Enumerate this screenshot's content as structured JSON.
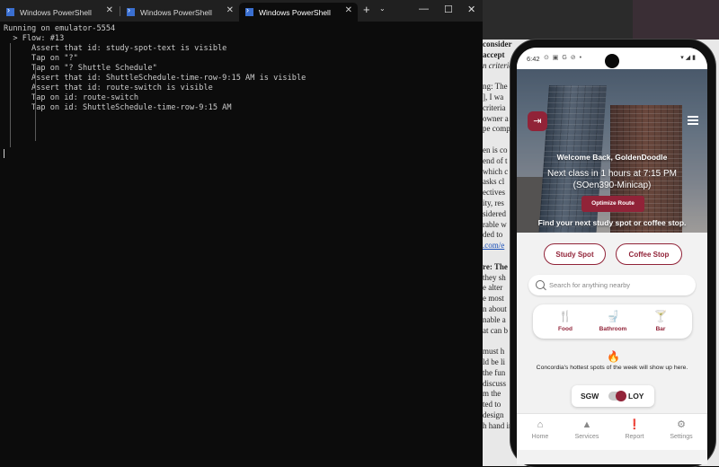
{
  "terminal": {
    "tabs": [
      {
        "title": "Windows PowerShell"
      },
      {
        "title": "Windows PowerShell"
      },
      {
        "title": "Windows PowerShell"
      }
    ],
    "new_tab": "+",
    "dropdown": "⌄",
    "win_min": "—",
    "win_max": "☐",
    "win_close": "✕",
    "tab_close": "✕",
    "lines": [
      "Running on emulator-5554",
      "",
      "",
      "  > Flow: #13",
      "",
      "      Assert that id: study-spot-text is visible",
      "      Tap on \"?\"",
      "      Tap on \"? Shuttle Schedule\"",
      "      Assert that id: ShuttleSchedule-time-row-9:15 AM is visible",
      "      Assert that id: route-switch is visible",
      "      Tap on id: route-switch",
      "      Tap on id: ShuttleSchedule-time-row-9:15 AM"
    ]
  },
  "background_doc": {
    "lines": [
      {
        "text": "consider",
        "style": "bold"
      },
      {
        "text": "accept",
        "style": "bold"
      },
      {
        "text": "n criteria",
        "style": "italic"
      },
      {
        "text": "",
        "style": ""
      },
      {
        "text": "ng: The",
        "style": ""
      },
      {
        "text": "], I wa",
        "style": ""
      },
      {
        "text": "criteria",
        "style": ""
      },
      {
        "text": "owner a",
        "style": ""
      },
      {
        "text": "pe comp",
        "style": ""
      },
      {
        "text": "",
        "style": ""
      },
      {
        "text": "en is co",
        "style": ""
      },
      {
        "text": "end of t",
        "style": ""
      },
      {
        "text": "which c",
        "style": ""
      },
      {
        "text": "asks cl",
        "style": ""
      },
      {
        "text": "ectives",
        "style": ""
      },
      {
        "text": "ity, res",
        "style": ""
      },
      {
        "text": "sidered",
        "style": ""
      },
      {
        "text": "rable w",
        "style": ""
      },
      {
        "text": "ded to",
        "style": ""
      },
      {
        "text": ".com/e",
        "style": "link"
      },
      {
        "text": "",
        "style": ""
      },
      {
        "text": "re: The",
        "style": "bold"
      },
      {
        "text": "they sh",
        "style": ""
      },
      {
        "text": "e alter",
        "style": ""
      },
      {
        "text": "e most",
        "style": ""
      },
      {
        "text": "n about",
        "style": ""
      },
      {
        "text": "nable a",
        "style": ""
      },
      {
        "text": "at can b",
        "style": ""
      },
      {
        "text": "",
        "style": ""
      },
      {
        "text": "must h",
        "style": ""
      },
      {
        "text": "ld be li",
        "style": ""
      },
      {
        "text": "the fun",
        "style": ""
      },
      {
        "text": "discuss",
        "style": ""
      },
      {
        "text": "m the",
        "style": ""
      },
      {
        "text": "ted to",
        "style": ""
      },
      {
        "text": "design",
        "style": ""
      },
      {
        "text": "h hand in",
        "style": ""
      }
    ]
  },
  "phone": {
    "status": {
      "time": "6:42",
      "icons": "⊙ ▣ G ⊘ •",
      "right": "▾◢▮"
    },
    "header": {
      "welcome": "Welcome Back, GoldenDoodle",
      "next_class": "Next class in 1 hours at 7:15 PM",
      "course": "(SOen390-Minicap)",
      "optimize": "Optimize Route",
      "find": "Find your next study spot or coffee stop."
    },
    "buttons": {
      "study": "Study Spot",
      "coffee": "Coffee Stop"
    },
    "search": {
      "placeholder": "Search for anything nearby"
    },
    "categories": [
      {
        "label": "Food",
        "icon": "🍴"
      },
      {
        "label": "Bathroom",
        "icon": "🚽"
      },
      {
        "label": "Bar",
        "icon": "🍸"
      }
    ],
    "hot": {
      "icon": "🔥",
      "text": "Concordia's hottest spots of the week will show up here."
    },
    "campus": {
      "left": "SGW",
      "right": "LOY"
    },
    "nav": [
      {
        "label": "Home",
        "icon": "⌂"
      },
      {
        "label": "Services",
        "icon": "▲"
      },
      {
        "label": "Report",
        "icon": "❗"
      },
      {
        "label": "Settings",
        "icon": "⚙"
      }
    ],
    "accent": "#912338"
  }
}
